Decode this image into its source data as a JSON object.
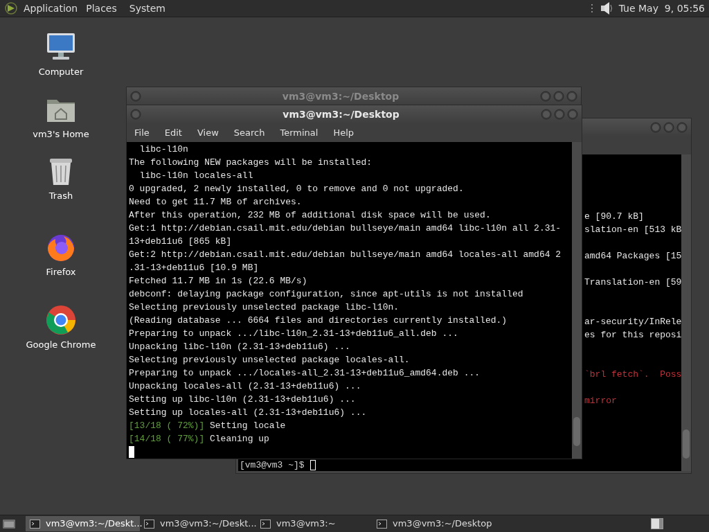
{
  "top_panel": {
    "menus": [
      "Application",
      "Places",
      "System"
    ],
    "clock": "Tue May  9, 05:56"
  },
  "desktop_icons": [
    {
      "kind": "computer",
      "label": "Computer"
    },
    {
      "kind": "home",
      "label": "vm3's Home"
    },
    {
      "kind": "trash",
      "label": "Trash"
    },
    {
      "kind": "firefox",
      "label": "Firefox"
    },
    {
      "kind": "chrome",
      "label": "Google Chrome"
    }
  ],
  "back_window_top": {
    "title": "vm3@vm3:~/Desktop"
  },
  "back_window": {
    "lines": [
      {
        "text": "e [90.7 kB]",
        "kind": "normal"
      },
      {
        "text": "slation-en [513 kB",
        "kind": "normal"
      },
      {
        "text": "amd64 Packages [15",
        "kind": "normal"
      },
      {
        "text": "Translation-en [59",
        "kind": "normal"
      },
      {
        "text": "ar-security/InRele",
        "kind": "normal"
      },
      {
        "text": "es for this reposi",
        "kind": "normal"
      },
      {
        "text": "`brl fetch`.  Poss",
        "kind": "error"
      },
      {
        "text": "mirror",
        "kind": "error"
      }
    ],
    "prompt": "[vm3@vm3 ~]$"
  },
  "main_window": {
    "title": "vm3@vm3:~/Desktop",
    "menu": [
      "File",
      "Edit",
      "View",
      "Search",
      "Terminal",
      "Help"
    ],
    "lines": [
      {
        "text": "  libc-l10n"
      },
      {
        "text": "The following NEW packages will be installed:"
      },
      {
        "text": "  libc-l10n locales-all"
      },
      {
        "text": "0 upgraded, 2 newly installed, 0 to remove and 0 not upgraded."
      },
      {
        "text": "Need to get 11.7 MB of archives."
      },
      {
        "text": "After this operation, 232 MB of additional disk space will be used."
      },
      {
        "text": "Get:1 http://debian.csail.mit.edu/debian bullseye/main amd64 libc-l10n all 2.31-"
      },
      {
        "text": "13+deb11u6 [865 kB]"
      },
      {
        "text": "Get:2 http://debian.csail.mit.edu/debian bullseye/main amd64 locales-all amd64 2"
      },
      {
        "text": ".31-13+deb11u6 [10.9 MB]"
      },
      {
        "text": "Fetched 11.7 MB in 1s (22.6 MB/s)"
      },
      {
        "text": "debconf: delaying package configuration, since apt-utils is not installed"
      },
      {
        "text": "Selecting previously unselected package libc-l10n."
      },
      {
        "text": "(Reading database ... 6664 files and directories currently installed.)"
      },
      {
        "text": "Preparing to unpack .../libc-l10n_2.31-13+deb11u6_all.deb ..."
      },
      {
        "text": "Unpacking libc-l10n (2.31-13+deb11u6) ..."
      },
      {
        "text": "Selecting previously unselected package locales-all."
      },
      {
        "text": "Preparing to unpack .../locales-all_2.31-13+deb11u6_amd64.deb ..."
      },
      {
        "text": "Unpacking locales-all (2.31-13+deb11u6) ..."
      },
      {
        "text": "Setting up libc-l10n (2.31-13+deb11u6) ..."
      },
      {
        "text": "Setting up locales-all (2.31-13+deb11u6) ..."
      },
      {
        "progress": "[13/18 ( 72%)]",
        "text": " Setting locale"
      },
      {
        "progress": "[14/18 ( 77%)]",
        "text": " Cleaning up"
      }
    ]
  },
  "taskbar": [
    {
      "label": "vm3@vm3:~/Deskt...",
      "selected": true
    },
    {
      "label": "vm3@vm3:~/Deskt...",
      "selected": false
    },
    {
      "label": "vm3@vm3:~",
      "selected": false
    },
    {
      "label": "vm3@vm3:~/Desktop",
      "selected": false
    }
  ]
}
